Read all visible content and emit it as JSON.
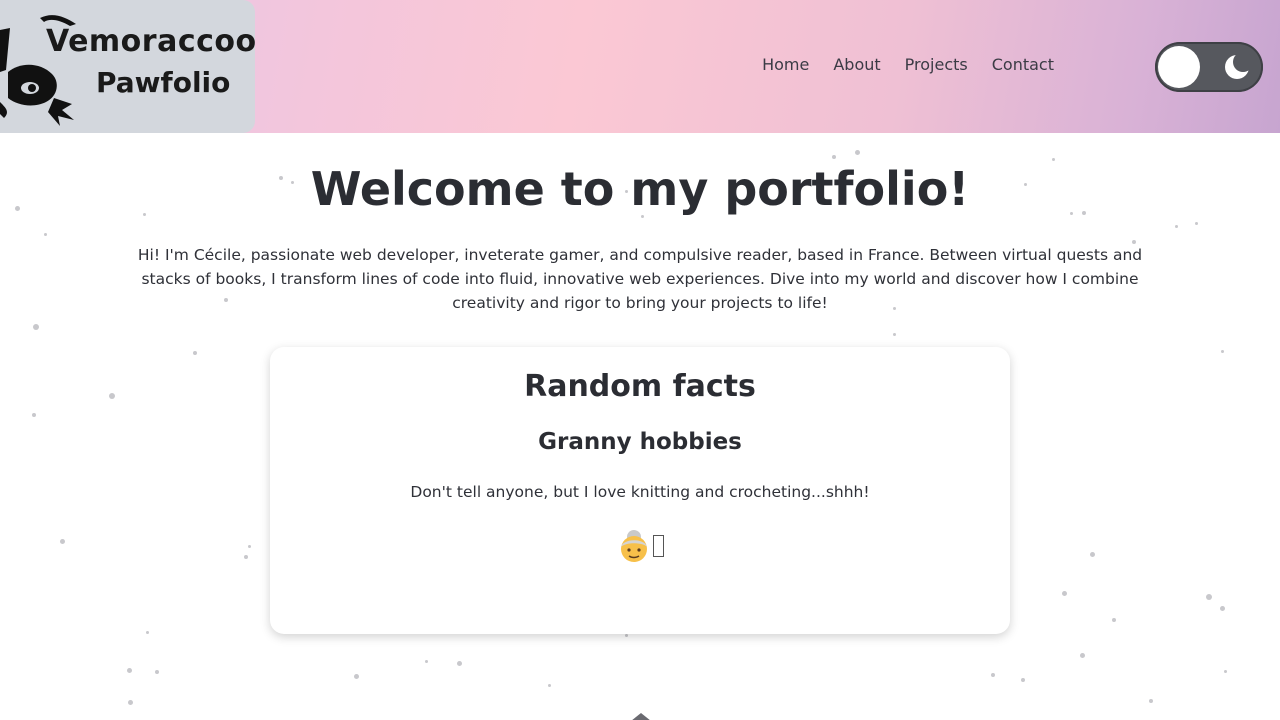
{
  "header": {
    "logo": {
      "line1": "Vemoraccoon",
      "line2": "Pawfolio"
    },
    "nav": [
      {
        "label": "Home"
      },
      {
        "label": "About"
      },
      {
        "label": "Projects"
      },
      {
        "label": "Contact"
      }
    ],
    "theme_toggle": {
      "state": "light",
      "icon": "moon-icon"
    }
  },
  "main": {
    "title": "Welcome to my portfolio!",
    "intro": "Hi! I'm Cécile, passionate web developer, inveterate gamer, and compulsive reader, based in France. Between virtual quests and stacks of books, I transform lines of code into fluid, innovative web experiences. Dive into my world and discover how I combine creativity and rigor to bring your projects to life!"
  },
  "facts_card": {
    "title": "Random facts",
    "fact_title": "Granny hobbies",
    "fact_text": "Don't tell anyone, but I love knitting and crocheting...shhh!",
    "emoji_icons": [
      "older-woman-emoji",
      "missing-glyph-box"
    ]
  },
  "colors": {
    "header_gradient_start": "#e5c6e9",
    "header_gradient_mid": "#fbc8d4",
    "header_gradient_end": "#c7a5d0",
    "logo_bg": "#d3d7dd",
    "text_dark": "#2b2d33",
    "toggle_bg": "#56585e"
  }
}
